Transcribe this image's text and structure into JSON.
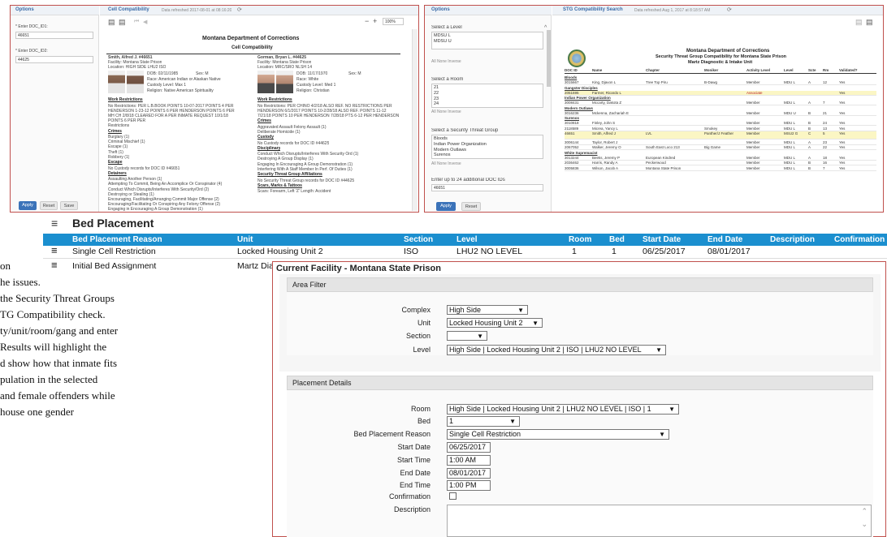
{
  "doc_text": {
    "lines": [
      "on",
      "he issues.",
      "the Security Threat Groups",
      "TG Compatibility check.",
      "ty/unit/room/gang and enter",
      "Results will highlight the",
      "d show how that inmate fits",
      "pulation in the selected",
      "",
      "and female offenders while",
      "house one gender"
    ]
  },
  "cell": {
    "options_title": "Options",
    "doc1_label": "* Enter DOC_ID1:",
    "doc1_value": "46651",
    "doc2_label": "* Enter DOC_ID2:",
    "doc2_value": "44625",
    "apply": "Apply",
    "reset": "Reset",
    "save": "Save",
    "tab_title": "Cell Compatibility",
    "refreshed": "Data refreshed 2017-08-01 at 08:16:20",
    "zoom": "100%",
    "report_title": "Montana Department of Corrections",
    "report_subtitle": "Cell Compatibility",
    "person1": {
      "name": "Smith, Alfred J. #46651",
      "facility": "Facility: Montana State Prison",
      "location": "Location: HIGH SIDE LHU2 ISO",
      "dob": "DOB: 02/11/1985",
      "race": "Race: American Indian or Alaskan Native",
      "sex": "Sex: M",
      "custody": "Custody Level: Max 1",
      "religion": "Religion: Native American Spirituality"
    },
    "person2": {
      "name": "Gorman, Bryan L. #44625",
      "facility": "Facility: Montana State Prison",
      "location": "Location: MRC/SRO NLSH 14",
      "dob": "DOB: 11/17/1970",
      "race": "Race: White",
      "sex": "Sex: M",
      "custody": "Custody Level: Med 1",
      "religion": "Religion: Christian"
    },
    "left_sections": [
      "Work Restrictions",
      "Crimes",
      "Escape",
      "Detainers",
      "Disciplinary"
    ],
    "left_items": [
      "No Restrictions: PER L.B.BOOK POINTS 10-07-2017 POINTS 4 PER",
      "HENDERSON 1-23-12 POINTS 6 PER HENDERSON POINTS 6 PER",
      "MH CH 2/8/18 CLEARED FOR A PER INMATE REQUEST 10/1/18",
      "POINTS 6 PER PER",
      "Restrictions",
      "Burglary (1)",
      "Criminal Mischief (1)",
      "Escape (1)",
      "Theft (1)",
      "Robbery (1)",
      "No Custody records for DOC ID #46651",
      "Assaulting Another Person (1)",
      "Attempting To Commit, Being An Accomplice Or Conspirator (4)",
      "Conduct Which Disrupts/Interferes With Security/Ord (2)",
      "Destroying or Stealing (1)",
      "Encouraging, Facilitating/Arranging Commit Major Offense (2)",
      "Encouraging/Facilitating Or Conspiring Any Felony Offense (2)",
      "Engaging in Encouraging A Group Demonstration (1)",
      "Escape, Attempting To Escape Or Planning To Escape (1)",
      "Extortion, Blackmail, Protection (2)",
      "Failure To Obey Written Institutional Policy (possibly) (1)"
    ],
    "right_sections": [
      "Work Restrictions",
      "Crimes",
      "Custody",
      "Disciplinary",
      "Security Threat Group Affiliations",
      "Scars, Marks & Tattoos"
    ],
    "right_items": [
      "No Restrictions: PER CHINO 4/2/18 ALSO REF. NO RESTRICTIONS PER",
      "HENDERSON 6/1/2017 POINTS 10-2/28/18 ALSO REF. POINTS 11-12",
      "7/21/18 POINTS 10 PER HENDERSON 7/28/18 PTS 6-12 PER HENDERSON",
      "Aggravated Assault Felony Assault (1)",
      "Deliberate Homicide (1)",
      "No Custody records for DOC ID #44625",
      "Conduct Which Disrupts/Interferes With Security Ord (1)",
      "Destroying A Group Display (1)",
      "Engaging In Encouraging A Group Demonstration (1)",
      "Interfering With A Staff Member In Perf. Of Duties (1)",
      "No Security Threat Group records for DOC ID #44625",
      "Scars: Forearm, Left 'Z' Length: Accident"
    ]
  },
  "stg": {
    "options_title": "Options",
    "level_label": "Select a Level",
    "levels": [
      "MDSU L",
      "MDSU U"
    ],
    "all_none": "All None Inverse",
    "room_label": "Select a Room",
    "rooms": [
      "21",
      "22",
      "23",
      "24"
    ],
    "group_label": "Select a Security Threat Group",
    "groups": [
      "Bloods",
      "Indian Power Organization",
      "Modern Outlaws",
      "Surenos"
    ],
    "doc_label": "Enter up to 24 additional DOC IDs",
    "doc_value": "46651",
    "apply": "Apply",
    "reset": "Reset",
    "tab_title": "STG Compatibility Search",
    "refreshed": "Data refreshed Aug 1, 2017 at 8:18:57 AM",
    "report_title": "Montana Department of Corrections",
    "report_subtitle": "Security Threat Group Compatibility for Montana State Prison",
    "report_subtitle2": "Martz Diagnostic & Intake Unit",
    "headers": [
      "DOC ID",
      "Name",
      "Chapter",
      "Moniker",
      "Activity Level",
      "Level",
      "Scte",
      "Rm",
      "Validated?"
    ],
    "groups_rows": [
      {
        "group": "Bloods",
        "rows": [
          [
            "3015667",
            "King, Djavon L",
            "Tree Top Piru",
            "B-Dawg",
            "Member",
            "MDU L",
            "A",
            "12",
            "Yes"
          ]
        ]
      },
      {
        "group": "Gangster Disciples",
        "rows": [
          [
            "2051695",
            "Farmer, Ricardo L",
            "",
            "",
            "Associate",
            "",
            "",
            "",
            "Yes"
          ]
        ]
      },
      {
        "group": "Indian Power Organization",
        "rows": [
          [
            "3008431",
            "Mccarty, Dakota Z",
            "",
            "",
            "Member",
            "MDU L",
            "A",
            "7",
            "Yes"
          ]
        ]
      },
      {
        "group": "Modern Outlaws",
        "rows": [
          [
            "3016236",
            "Mckenna, Zachariah E",
            "",
            "",
            "Member",
            "MDU U",
            "B",
            "21",
            "Yes"
          ]
        ]
      },
      {
        "group": "Surenos",
        "rows": [
          [
            "3010818",
            "Finley, John S",
            "",
            "",
            "Member",
            "MDU L",
            "B",
            "24",
            "Yes"
          ],
          [
            "2118589",
            "Micrea, Yancy L",
            "",
            "Smokey",
            "Member",
            "MDU L",
            "B",
            "13",
            "Yes"
          ],
          [
            "46651",
            "Smith, Alfred J",
            "LVL",
            "Panther/J Feather",
            "Member",
            "MSU2 G",
            "C",
            "5",
            "Yes"
          ],
          [
            "3006144",
            "Taylor, Robert J",
            "",
            "",
            "Member",
            "MDU L",
            "A",
            "23",
            "Yes"
          ],
          [
            "2067052",
            "Walker, Jeremy O",
            "South East Loco 213",
            "Big Game",
            "Member",
            "MDU L",
            "A",
            "22",
            "Yes"
          ]
        ]
      },
      {
        "group": "White Supremacist",
        "rows": [
          [
            "3013244",
            "Beeks, Jeremy P",
            "European Kindred",
            "",
            "Member",
            "MDU L",
            "A",
            "18",
            "Yes"
          ],
          [
            "2036462",
            "Harris, Randy A",
            "Peckerwood",
            "",
            "Member",
            "MDU L",
            "B",
            "16",
            "Yes"
          ],
          [
            "3005836",
            "Wilson, Jacob A",
            "Montana State Prison",
            "",
            "Member",
            "MDU L",
            "B",
            "7",
            "Yes"
          ]
        ]
      }
    ]
  },
  "bed": {
    "title": "Bed Placement",
    "headers": [
      "Bed Placement Reason",
      "Unit",
      "Section",
      "Level",
      "Room",
      "Bed",
      "Start Date",
      "End Date",
      "Description",
      "Confirmation"
    ],
    "rows": [
      {
        "reason": "Single Cell Restriction",
        "unit": "Locked Housing Unit 2",
        "section": "ISO",
        "level": "LHU2 NO LEVEL",
        "room": "1",
        "bed": "1",
        "start": "06/25/2017",
        "end": "08/01/2017"
      },
      {
        "reason": "Initial Bed Assignment",
        "unit": "Martz Dia"
      }
    ]
  },
  "facility": {
    "title": "Current Facility - Montana State Prison",
    "area_filter": "Area Filter",
    "complex_label": "Complex",
    "complex_value": "High Side",
    "unit_label": "Unit",
    "unit_value": "Locked Housing Unit 2",
    "section_label": "Section",
    "section_value": "",
    "level_label": "Level",
    "level_value": "High Side | Locked Housing Unit 2 | ISO | LHU2 NO LEVEL",
    "placement_details": "Placement Details",
    "room_label": "Room",
    "room_value": "High Side | Locked Housing Unit 2 | LHU2 NO LEVEL | ISO | 1",
    "bed_label": "Bed",
    "bed_value": "1",
    "reason_label": "Bed Placement Reason",
    "reason_value": "Single Cell Restriction",
    "start_date_label": "Start Date",
    "start_date_value": "06/25/2017",
    "start_time_label": "Start Time",
    "start_time_value": "1:00 AM",
    "end_date_label": "End Date",
    "end_date_value": "08/01/2017",
    "end_time_label": "End Time",
    "end_time_value": "1:00 PM",
    "confirmation_label": "Confirmation",
    "description_label": "Description"
  }
}
